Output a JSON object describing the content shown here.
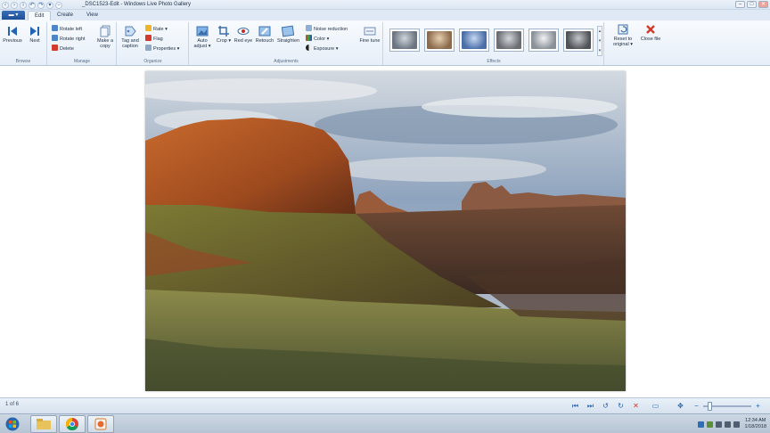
{
  "window": {
    "title": "_DSC1523-Edit - Windows Live Photo Gallery",
    "file_menu_label": "",
    "tabs": [
      {
        "label": "Edit",
        "active": true
      },
      {
        "label": "Create",
        "active": false
      },
      {
        "label": "View",
        "active": false
      }
    ],
    "controls": {
      "minimize": "–",
      "maximize": "□",
      "close": "✕"
    }
  },
  "ribbon": {
    "groups": {
      "browse": "Browse",
      "manage": "Manage",
      "organize": "Organize",
      "adjustments": "Adjustments",
      "effects": "Effects"
    },
    "browse": {
      "previous": "Previous",
      "next": "Next"
    },
    "manage": {
      "rotate_left": "Rotate left",
      "rotate_right": "Rotate right",
      "delete": "Delete",
      "make_copy": "Make a copy"
    },
    "organize": {
      "tag_caption": "Tag and caption",
      "rate": "Rate",
      "flag": "Flag",
      "properties": "Properties"
    },
    "adjustments": {
      "auto_adjust": "Auto adjust",
      "crop": "Crop",
      "red_eye": "Red eye",
      "retouch": "Retouch",
      "straighten": "Straighten",
      "noise_reduction": "Noise reduction",
      "color": "Color",
      "exposure": "Exposure",
      "fine_tune": "Fine tune"
    },
    "effects_swatches": [
      "#6c7581",
      "#8c6b4d",
      "#4a6ea8",
      "#6a6e73",
      "#8a9098",
      "#4f5257"
    ],
    "reset": "Reset to original",
    "close_file": "Close file"
  },
  "status": {
    "count": "1 of 6",
    "zoom_level": 0.1
  },
  "taskbar": {
    "time": "12:34 AM",
    "date": "1/18/2018"
  },
  "colors": {
    "accent": "#2463b1",
    "ribbon_bg": "#e6eef8",
    "close_red": "#d23a2b"
  }
}
